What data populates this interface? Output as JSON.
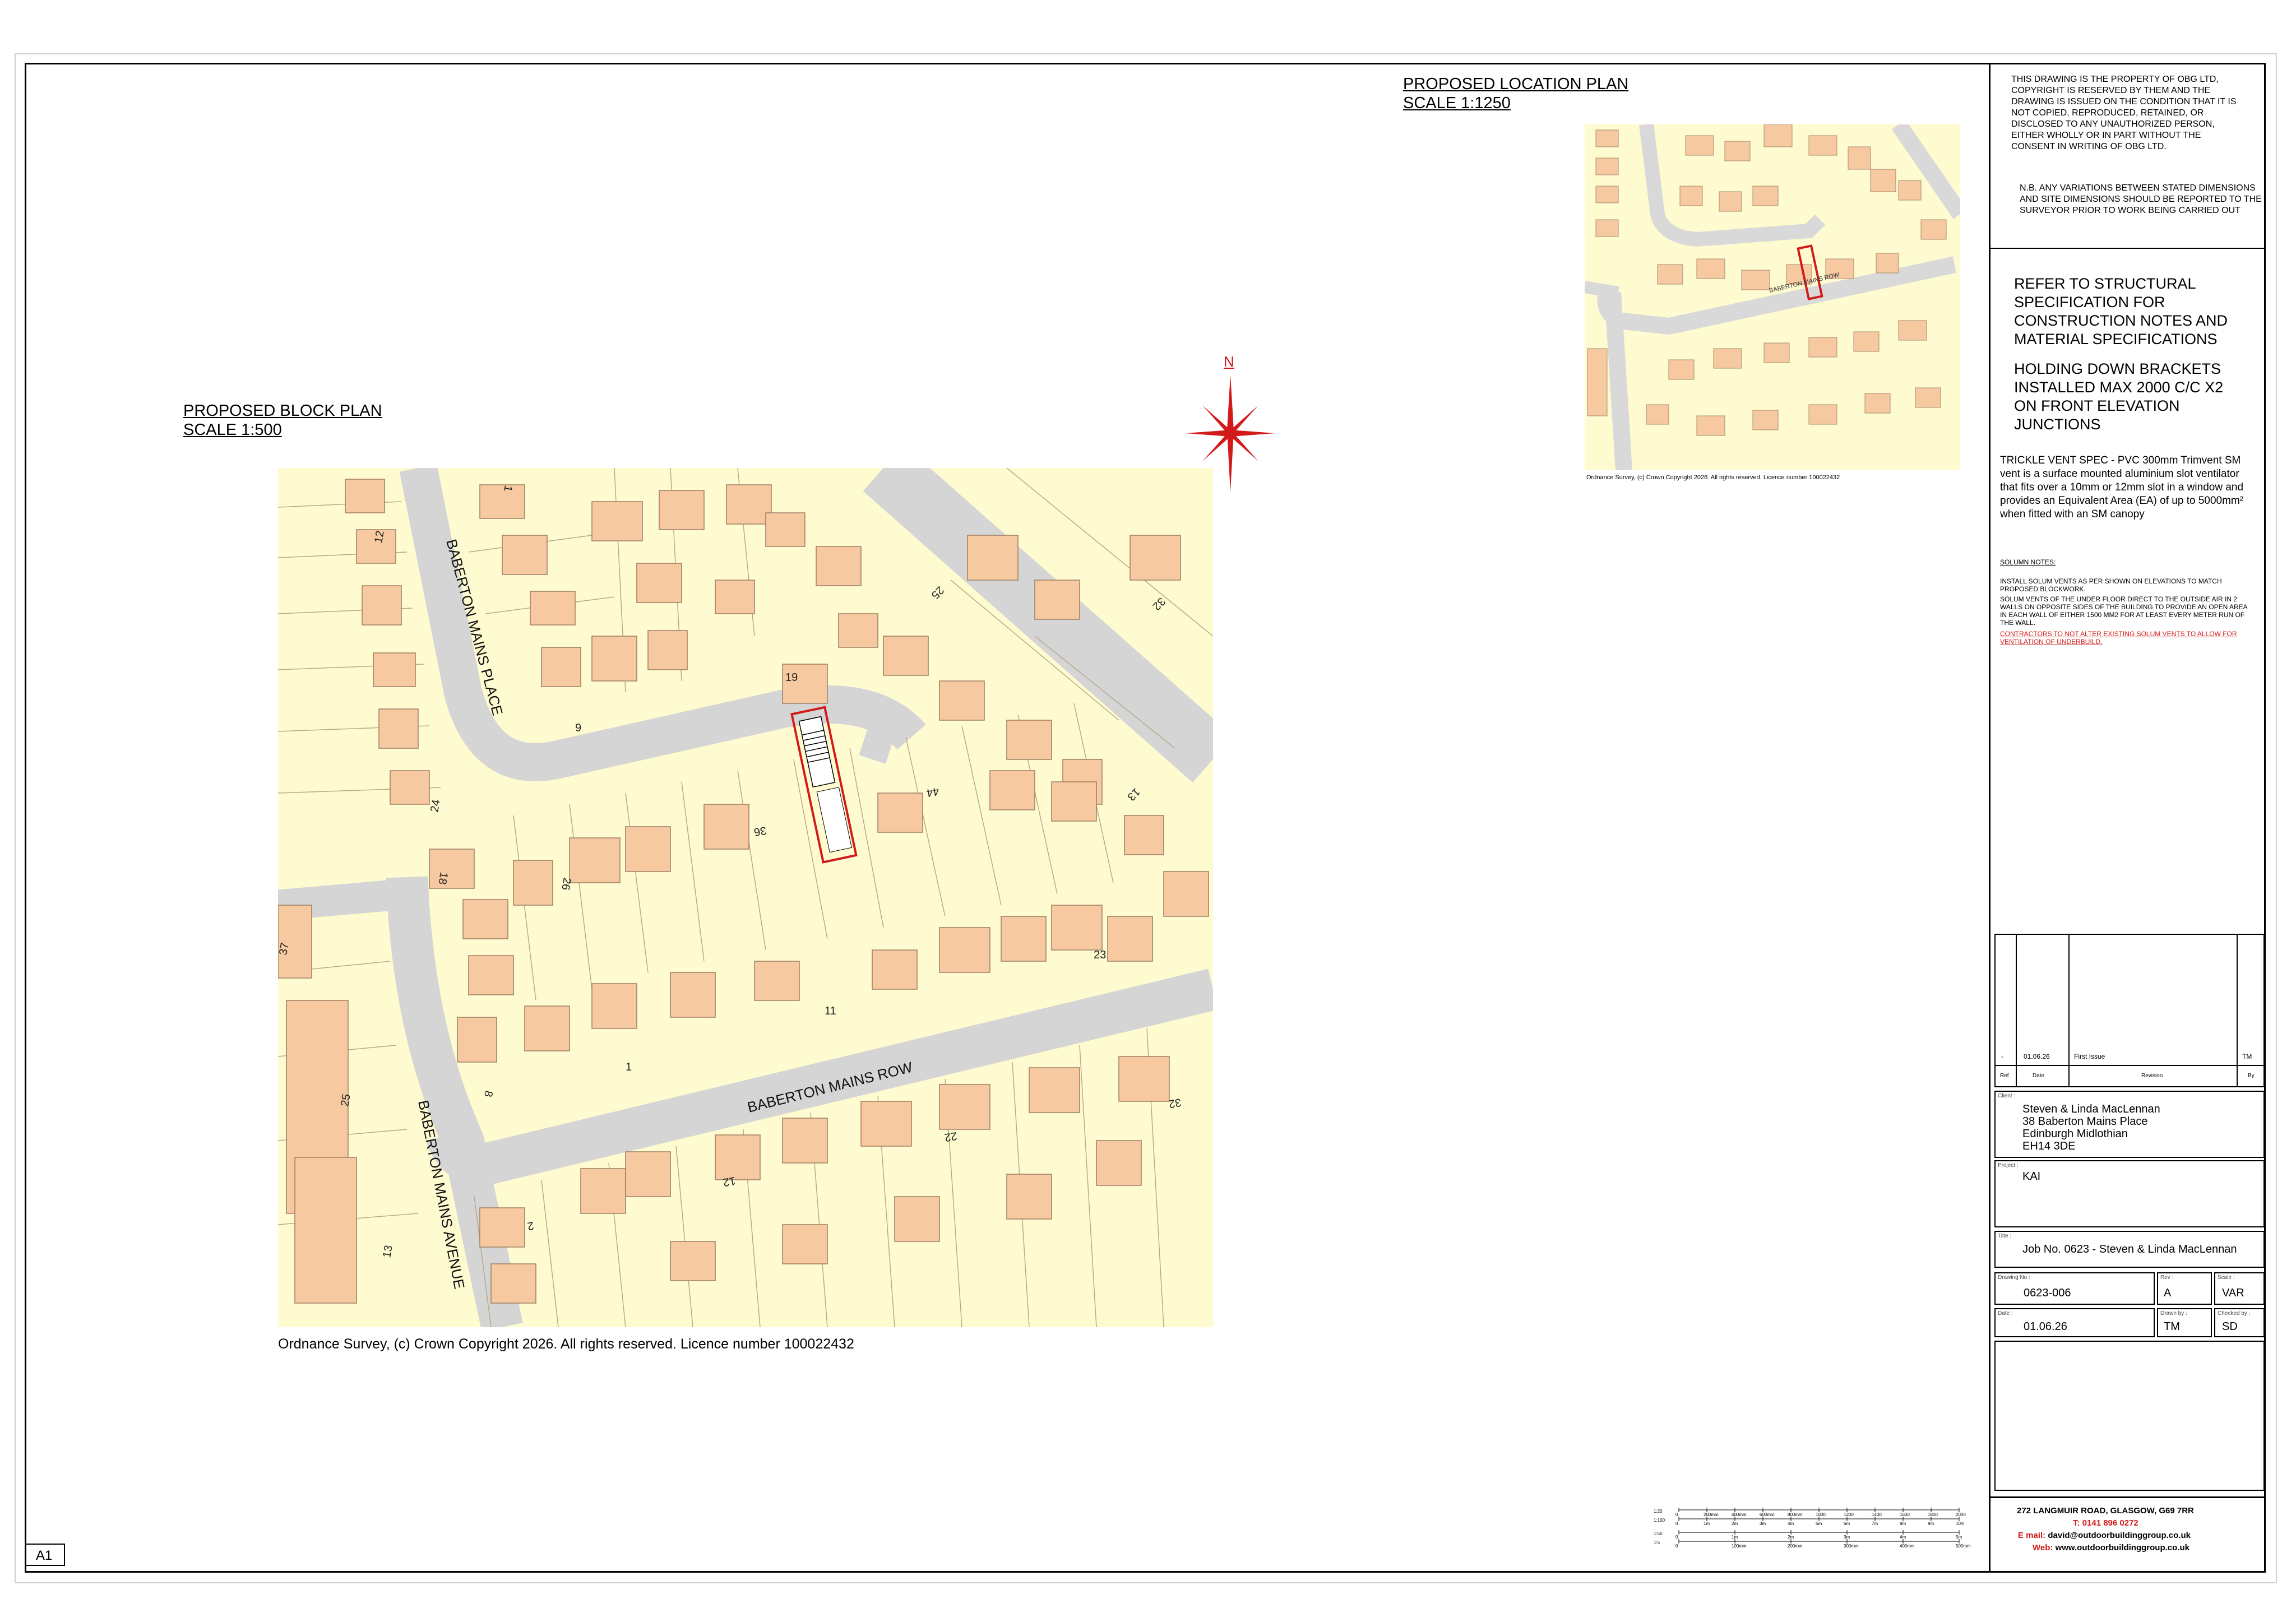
{
  "sheet": {
    "size_label": "A1"
  },
  "block_plan": {
    "heading": "PROPOSED BLOCK PLAN",
    "scale": "SCALE 1:500",
    "copyright": "Ordnance Survey, (c) Crown Copyright 2026. All rights reserved. Licence number 100022432",
    "roads": {
      "place": "BABERTON MAINS PLACE",
      "row": "BABERTON MAINS ROW",
      "avenue": "BABERTON MAINS AVENUE"
    },
    "house_numbers": [
      "1",
      "12",
      "25",
      "32",
      "19",
      "9",
      "24",
      "36",
      "44",
      "13",
      "18",
      "26",
      "37",
      "23",
      "11",
      "8",
      "1",
      "25",
      "32",
      "22",
      "12",
      "2",
      "13"
    ],
    "north_label": "N"
  },
  "location_plan": {
    "heading": "PROPOSED LOCATION PLAN",
    "scale": "SCALE 1:1250",
    "copyright": "Ordnance Survey, (c) Crown Copyright 2026. All rights reserved. Licence number 100022432",
    "road_label": "BABERTON MAINS ROW"
  },
  "title_block": {
    "property_notice": "THIS DRAWING IS THE PROPERTY OF OBG LTD, COPYRIGHT IS RESERVED BY THEM AND THE DRAWING IS ISSUED ON THE CONDITION THAT IT IS NOT COPIED, REPRODUCED, RETAINED, OR DISCLOSED TO ANY UNAUTHORIZED PERSON, EITHER WHOLLY OR IN PART WITHOUT THE CONSENT IN WRITING OF OBG LTD.",
    "nb_notice": "N.B. ANY VARIATIONS BETWEEN STATED DIMENSIONS AND SITE DIMENSIONS SHOULD BE REPORTED TO THE SURVEYOR PRIOR TO WORK BEING CARRIED OUT",
    "structural_note": "REFER TO STRUCTURAL SPECIFICATION FOR CONSTRUCTION NOTES AND MATERIAL SPECIFICATIONS",
    "holding_note": "HOLDING DOWN BRACKETS INSTALLED MAX 2000 C/C X2 ON FRONT ELEVATION JUNCTIONS",
    "trickle_note": "TRICKLE VENT SPEC - PVC 300mm Trimvent SM vent is a surface mounted aluminium slot ventilator that fits over a 10mm or 12mm slot in a window and provides an Equivalent Area (EA) of up to 5000mm² when fitted with an SM canopy",
    "solum_heading": "SOLUMN NOTES:",
    "solum_line1": "INSTALL SOLUM VENTS AS PER SHOWN ON ELEVATIONS TO MATCH PROPOSED BLOCKWORK.",
    "solum_line2": "SOLUM VENTS OF THE UNDER FLOOR DIRECT TO THE OUTSIDE AIR IN 2 WALLS ON OPPOSITE SIDES OF THE BUILDING TO PROVIDE AN OPEN AREA IN EACH WALL OF EITHER 1500 MM2 FOR AT LEAST EVERY METER RUN OF THE WALL.",
    "solum_warning": "CONTRACTORS TO NOT ALTER EXISTING SOLUM VENTS TO ALLOW FOR VENTILATION OF UNDERBUILD.",
    "revisions": {
      "rows": [
        {
          "ref": "-",
          "date": "01.06.26",
          "revision": "First Issue",
          "by": "TM"
        }
      ],
      "headers": {
        "ref": "Ref",
        "date": "Date",
        "revision": "Revision",
        "by": "By"
      }
    },
    "client_label": "Client :",
    "client_lines": [
      "Steven & Linda MacLennan",
      "38 Baberton Mains Place",
      "Edinburgh Midlothian",
      "EH14 3DE"
    ],
    "project_label": "Project :",
    "project": "KAI",
    "title_label": "Title :",
    "title": "Job No. 0623 - Steven & Linda MacLennan",
    "drawing_no_label": "Drawing No :",
    "drawing_no": "0623-006",
    "rev_label": "Rev :",
    "rev": "A",
    "scale_label": "Scale :",
    "scale": "VAR",
    "date_label": "Date :",
    "date": "01.06.26",
    "drawn_label": "Drawn by :",
    "drawn": "TM",
    "checked_label": "Checked by :",
    "checked": "SD",
    "company_address": "272 LANGMUIR ROAD, GLASGOW, G69 7RR",
    "tel_label": "T:",
    "tel": "0141 896 0272",
    "email_label": "E mail:",
    "email": "david@outdoorbuildinggroup.co.uk",
    "web_label": "Web:",
    "web": "www.outdoorbuildinggroup.co.uk"
  },
  "scale_bar": {
    "ratios": [
      "1:20",
      "1:100",
      "1:50",
      "1:5"
    ],
    "top_ticks": [
      "0",
      "200mm",
      "400mm",
      "600mm",
      "800mm",
      "1000",
      "1200",
      "1400",
      "1600",
      "1800",
      "2000"
    ],
    "mid_ticks": [
      "0",
      "1m",
      "2m",
      "3m",
      "4m",
      "5m",
      "6m",
      "7m",
      "8m",
      "9m",
      "10m"
    ],
    "low_ticks": [
      "0",
      "1m",
      "2m",
      "3m",
      "4m",
      "5m"
    ],
    "bottom_ticks": [
      "0",
      "100mm",
      "200mm",
      "300mm",
      "400mm",
      "500mm"
    ]
  },
  "colors": {
    "map_fill": "#fffbd0",
    "building": "#f7c9a0",
    "road": "#d9d9d9",
    "site": "#d21a1a",
    "north": "#d21a1a"
  }
}
